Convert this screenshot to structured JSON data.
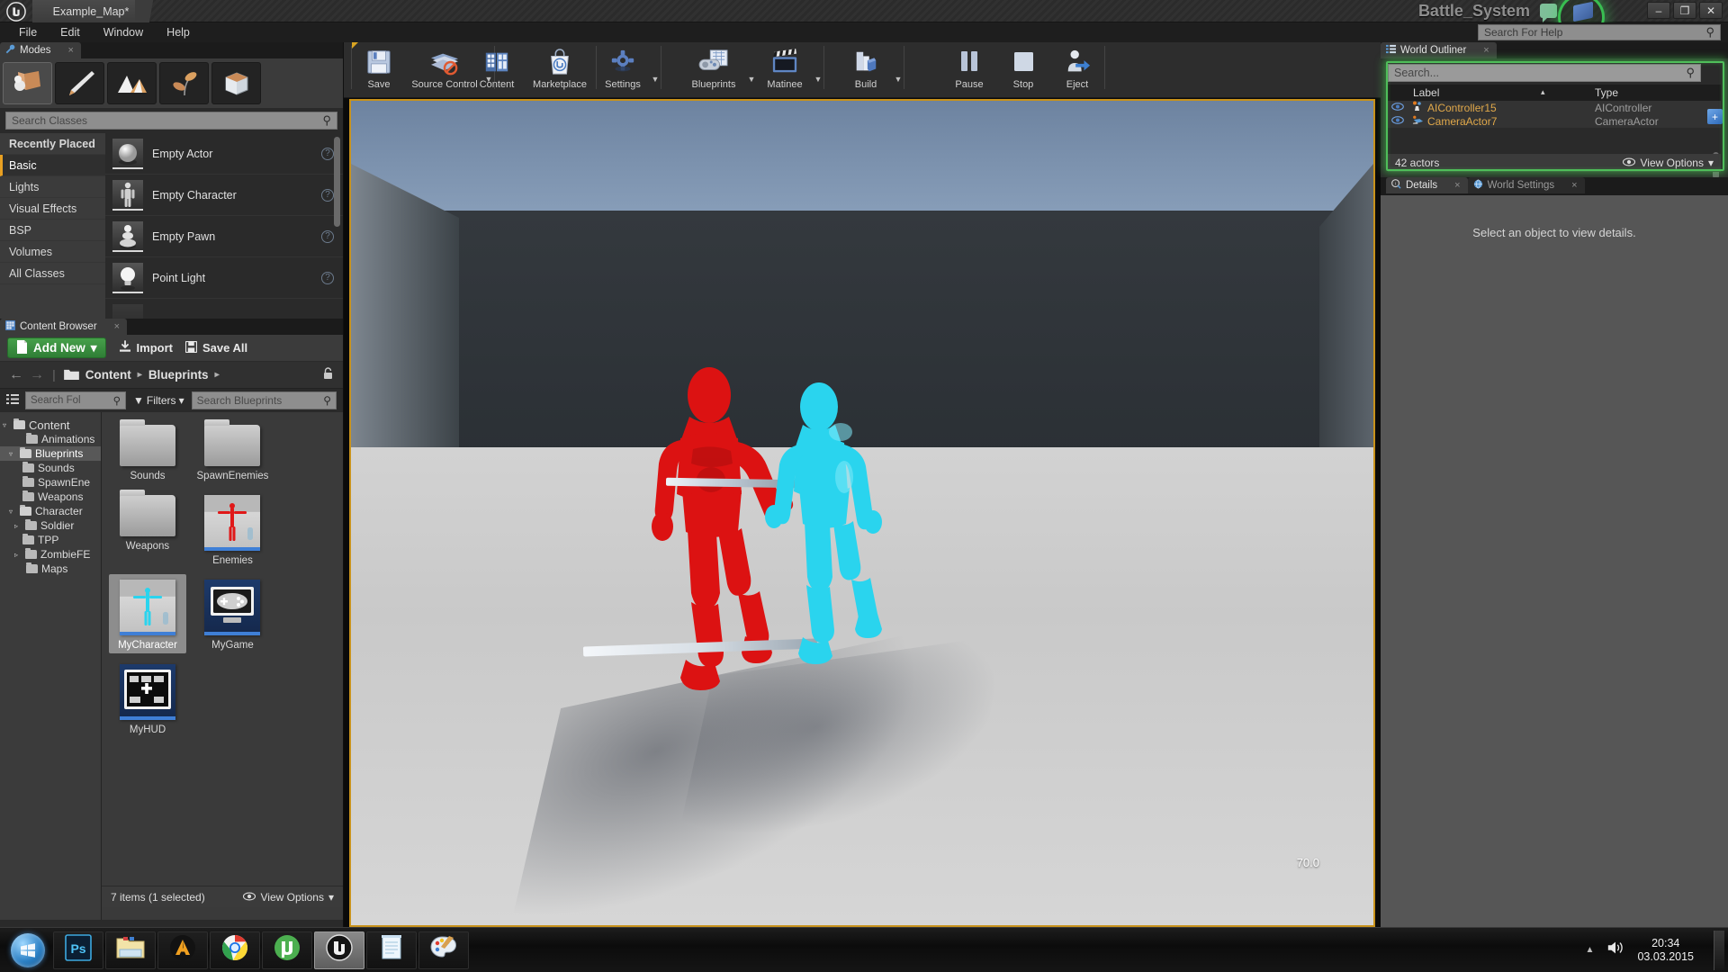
{
  "titlebar": {
    "logo": "unreal-logo-icon",
    "document_tab": "Example_Map*",
    "project_title": "Battle_System",
    "minimize": "–",
    "restore": "❐",
    "close": "✕"
  },
  "menubar": {
    "items": [
      "File",
      "Edit",
      "Window",
      "Help"
    ],
    "help_search_placeholder": "Search For Help"
  },
  "modes": {
    "tab_label": "Modes",
    "tab_close": "×",
    "mode_buttons": [
      "place-mode-icon",
      "paint-mode-icon",
      "landscape-mode-icon",
      "foliage-mode-icon",
      "geometry-edit-mode-icon"
    ],
    "search_placeholder": "Search Classes",
    "categories": [
      {
        "label": "Recently Placed",
        "selected": false
      },
      {
        "label": "Basic",
        "selected": true
      },
      {
        "label": "Lights",
        "selected": false
      },
      {
        "label": "Visual Effects",
        "selected": false
      },
      {
        "label": "BSP",
        "selected": false
      },
      {
        "label": "Volumes",
        "selected": false
      },
      {
        "label": "All Classes",
        "selected": false
      }
    ],
    "assets": [
      {
        "label": "Empty Actor",
        "icon": "sphere-actor-icon"
      },
      {
        "label": "Empty Character",
        "icon": "character-icon"
      },
      {
        "label": "Empty Pawn",
        "icon": "pawn-icon"
      },
      {
        "label": "Point Light",
        "icon": "point-light-icon"
      }
    ],
    "help_glyph": "?"
  },
  "toolbar": {
    "items": [
      {
        "label": "Save",
        "icon": "save-icon",
        "caret": false
      },
      {
        "label": "Source Control",
        "icon": "source-control-icon",
        "caret": true
      },
      {
        "label": "Content",
        "icon": "content-icon",
        "caret": false
      },
      {
        "label": "Marketplace",
        "icon": "marketplace-icon",
        "caret": false
      },
      {
        "label": "Settings",
        "icon": "settings-gear-icon",
        "caret": true
      },
      {
        "label": "Blueprints",
        "icon": "blueprints-icon",
        "caret": true
      },
      {
        "label": "Matinee",
        "icon": "matinee-clapper-icon",
        "caret": true
      },
      {
        "label": "Build",
        "icon": "build-icon",
        "caret": true
      },
      {
        "label": "Pause",
        "icon": "pause-icon",
        "caret": false
      },
      {
        "label": "Stop",
        "icon": "stop-icon",
        "caret": false
      },
      {
        "label": "Eject",
        "icon": "eject-icon",
        "caret": false
      }
    ]
  },
  "content_browser": {
    "tab_label": "Content Browser",
    "tab_close": "×",
    "add_new_label": "Add New",
    "add_new_caret": "▾",
    "import_label": "Import",
    "save_all_label": "Save All",
    "nav_back": "←",
    "nav_forward": "→",
    "breadcrumbs": [
      "Content",
      "Blueprints"
    ],
    "breadcrumb_sep": "▸",
    "folder_search_placeholder": "Search Fol",
    "filters_label": "Filters",
    "filters_caret": "▾",
    "asset_search_placeholder": "Search Blueprints",
    "tree": [
      {
        "label": "Content",
        "indent": 0,
        "tri": "▿",
        "selected": false,
        "open": true
      },
      {
        "label": "Animations",
        "indent": 1,
        "tri": "",
        "selected": false,
        "open": false
      },
      {
        "label": "Blueprints",
        "indent": 1,
        "tri": "▿",
        "selected": true,
        "open": true
      },
      {
        "label": "Sounds",
        "indent": 2,
        "tri": "",
        "selected": false,
        "open": false
      },
      {
        "label": "SpawnEne",
        "indent": 2,
        "tri": "",
        "selected": false,
        "open": false
      },
      {
        "label": "Weapons",
        "indent": 2,
        "tri": "",
        "selected": false,
        "open": false
      },
      {
        "label": "Character",
        "indent": 1,
        "tri": "▿",
        "selected": false,
        "open": true
      },
      {
        "label": "Soldier",
        "indent": 2,
        "tri": "▹",
        "selected": false,
        "open": false
      },
      {
        "label": "TPP",
        "indent": 2,
        "tri": "",
        "selected": false,
        "open": false
      },
      {
        "label": "ZombieFE",
        "indent": 2,
        "tri": "▹",
        "selected": false,
        "open": false
      },
      {
        "label": "Maps",
        "indent": 1,
        "tri": "",
        "selected": false,
        "open": false
      }
    ],
    "tiles": [
      {
        "label": "Sounds",
        "kind": "folder",
        "selected": false
      },
      {
        "label": "SpawnEnemies",
        "kind": "folder",
        "selected": false
      },
      {
        "label": "Weapons",
        "kind": "folder",
        "selected": false
      },
      {
        "label": "Enemies",
        "kind": "blueprint-red-character",
        "selected": false
      },
      {
        "label": "MyCharacter",
        "kind": "blueprint-cyan-character",
        "selected": true
      },
      {
        "label": "MyGame",
        "kind": "blueprint-gamemode",
        "selected": false
      },
      {
        "label": "MyHUD",
        "kind": "blueprint-hud",
        "selected": false
      }
    ],
    "status": "7 items (1 selected)",
    "view_options": "View Options",
    "view_options_caret": "▾"
  },
  "viewport": {
    "fps_value": "70.0",
    "figures": [
      "red-character",
      "cyan-character"
    ]
  },
  "outliner": {
    "tab_label": "World Outliner",
    "tab_close": "×",
    "search_placeholder": "Search...",
    "add_button": "+",
    "columns": {
      "label": "Label",
      "type": "Type"
    },
    "sort_caret": "▴",
    "type_filter_caret": "☲",
    "rows": [
      {
        "eye": "visibility-eye-icon",
        "icon": "ai-controller-icon",
        "label": "AIController15",
        "type": "AIController"
      },
      {
        "eye": "visibility-eye-icon",
        "icon": "camera-actor-icon",
        "label": "CameraActor7",
        "type": "CameraActor"
      }
    ],
    "actor_count": "42 actors",
    "view_options": "View Options",
    "view_options_caret": "▾"
  },
  "details": {
    "tabs": [
      {
        "label": "Details",
        "icon": "details-info-icon",
        "active": true,
        "close": "×"
      },
      {
        "label": "World Settings",
        "icon": "world-globe-icon",
        "active": false,
        "close": "×"
      }
    ],
    "empty_message": "Select an object to view details."
  },
  "taskbar": {
    "start": "windows-start-orb-icon",
    "apps": [
      {
        "name": "photoshop-icon",
        "glyph": "Ps",
        "active": false
      },
      {
        "name": "file-explorer-icon",
        "glyph": "",
        "active": false
      },
      {
        "name": "amd-icon",
        "glyph": "△",
        "active": false
      },
      {
        "name": "chrome-icon",
        "glyph": "",
        "active": false
      },
      {
        "name": "utorrent-icon",
        "glyph": "μ",
        "active": false
      },
      {
        "name": "unreal-engine-icon",
        "glyph": "",
        "active": true
      },
      {
        "name": "notepad-icon",
        "glyph": "",
        "active": false
      },
      {
        "name": "paint-icon",
        "glyph": "",
        "active": false
      }
    ],
    "tray_up_caret": "▲",
    "volume": "volume-icon",
    "time": "20:34",
    "date": "03.03.2015"
  },
  "colors": {
    "accent_orange": "#c8921b",
    "outliner_glow_green": "#4fbe5a",
    "addnew_green": "#2f7e36",
    "label_orange": "#e0a84a",
    "red_character": "#e01818",
    "cyan_character": "#2ad4ee"
  }
}
